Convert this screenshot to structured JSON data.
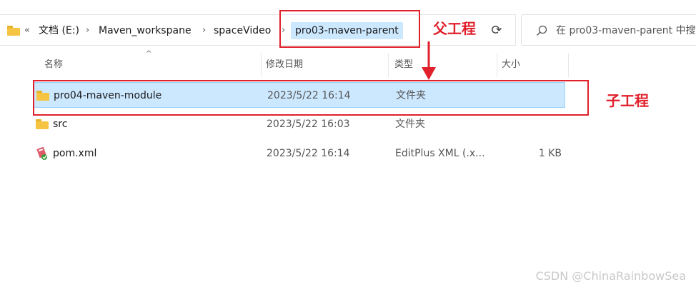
{
  "address_bar": {
    "back_chevron": "«",
    "crumbs": [
      "文档 (E:)",
      "Maven_workspane",
      "spaceVideo",
      "pro03-maven-parent"
    ],
    "separator": "›",
    "refresh_icon": "refresh-icon"
  },
  "search": {
    "placeholder": "在 pro03-maven-parent 中搜"
  },
  "columns": {
    "name": "名称",
    "date": "修改日期",
    "type": "类型",
    "size": "大小",
    "sort_indicator": "^"
  },
  "rows": [
    {
      "name": "pro04-maven-module",
      "date": "2023/5/22 16:14",
      "type": "文件夹",
      "size": "",
      "icon": "folder-icon",
      "selected": true
    },
    {
      "name": "src",
      "date": "2023/5/22 16:03",
      "type": "文件夹",
      "size": "",
      "icon": "folder-icon",
      "selected": false
    },
    {
      "name": "pom.xml",
      "date": "2023/5/22 16:14",
      "type": "EditPlus XML (.x...",
      "size": "1 KB",
      "icon": "xml-file-icon",
      "selected": false
    }
  ],
  "annotations": {
    "parent_label": "父工程",
    "child_label": "子工程",
    "color": "#e0202b"
  },
  "watermark": "CSDN @ChinaRainbowSea"
}
